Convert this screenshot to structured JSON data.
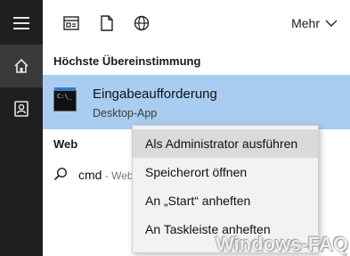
{
  "sidebar": {
    "menu_icon": "hamburger-icon",
    "home_icon": "home-icon",
    "contact_icon": "contact-card-icon"
  },
  "topbar": {
    "icons": [
      "apps-icon",
      "document-icon",
      "globe-icon"
    ],
    "more_label": "Mehr"
  },
  "best_match": {
    "heading": "Höchste Übereinstimmung",
    "title": "Eingabeaufforderung",
    "subtitle": "Desktop-App",
    "icon": "command-prompt-icon",
    "icon_text": "C:\\_"
  },
  "web": {
    "heading": "Web",
    "query": "cmd",
    "suffix": " - Web"
  },
  "context_menu": {
    "items": [
      "Als Administrator ausführen",
      "Speicherort öffnen",
      "An „Start“ anheften",
      "An Taskleiste anheften"
    ],
    "highlighted_index": 0
  },
  "watermark": "Windows-FAQ",
  "colors": {
    "sidebar": "#1f1f1f",
    "selection": "#a9cdf0",
    "menu_bg": "#f2f2f2",
    "menu_hover": "#dadada"
  }
}
